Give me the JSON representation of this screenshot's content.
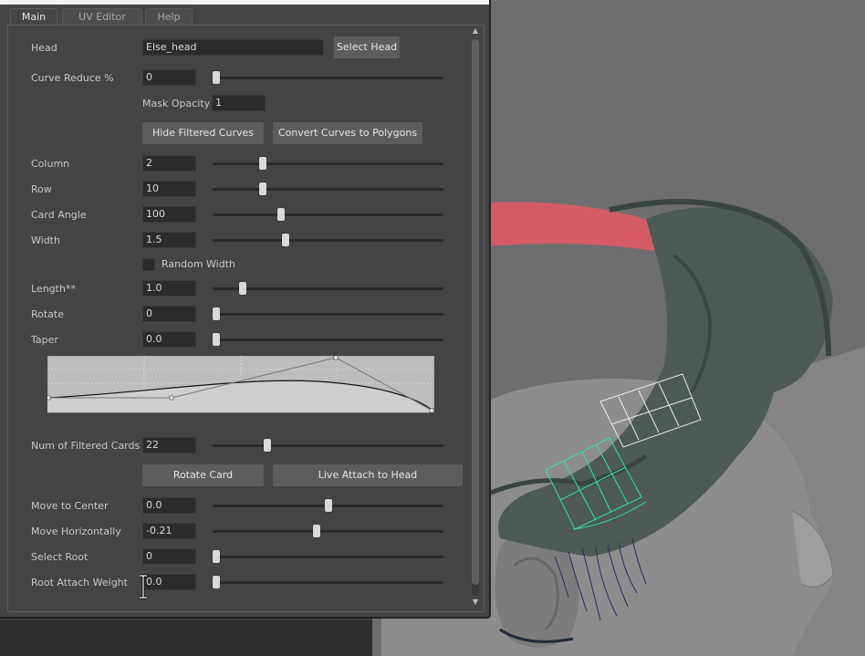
{
  "tabs": [
    {
      "label": "Main",
      "active": true
    },
    {
      "label": "UV Editor",
      "active": false
    },
    {
      "label": "Help",
      "active": false
    }
  ],
  "head": {
    "label": "Head",
    "value": "Else_head",
    "select_button": "Select Head"
  },
  "curve_reduce": {
    "label": "Curve Reduce %",
    "value": "0",
    "slider": 0.0
  },
  "mask_opacity": {
    "label": "Mask Opacity",
    "value": "1"
  },
  "buttons_row1": {
    "hide_filtered": "Hide Filtered Curves",
    "convert": "Convert Curves to Polygons"
  },
  "params": [
    {
      "label": "Column",
      "value": "2",
      "slider": 0.21
    },
    {
      "label": "Row",
      "value": "10",
      "slider": 0.21
    },
    {
      "label": "Card Angle",
      "value": "100",
      "slider": 0.29
    },
    {
      "label": "Width",
      "value": "1.5",
      "slider": 0.31
    }
  ],
  "random_width": {
    "label": "Random Width",
    "checked": false
  },
  "params2": [
    {
      "label": "Length**",
      "value": "1.0",
      "slider": 0.12
    },
    {
      "label": "Rotate",
      "value": "0",
      "slider": 0.0
    },
    {
      "label": "Taper",
      "value": "0.0",
      "slider": 0.0
    }
  ],
  "filtered_cards": {
    "label": "Num of Filtered Cards",
    "value": "22",
    "slider": 0.23
  },
  "buttons_row2": {
    "rotate": "Rotate Card",
    "live_attach": "Live Attach to Head"
  },
  "params3": [
    {
      "label": "Move to Center",
      "value": "0.0",
      "slider": 0.5
    },
    {
      "label": "Move Horizontally",
      "value": "-0.21",
      "slider": 0.45
    },
    {
      "label": "Select Root",
      "value": "0",
      "slider": 0.0
    },
    {
      "label": "Root Attach Weight",
      "value": "0.0",
      "slider": 0.0
    }
  ],
  "colors": {
    "panel_bg": "#444444",
    "viewport_bg": "#6e6e6e",
    "hair_green": "#4e5a54",
    "scalp_red": "#e05a66",
    "selection_cyan": "#35e0b0"
  }
}
